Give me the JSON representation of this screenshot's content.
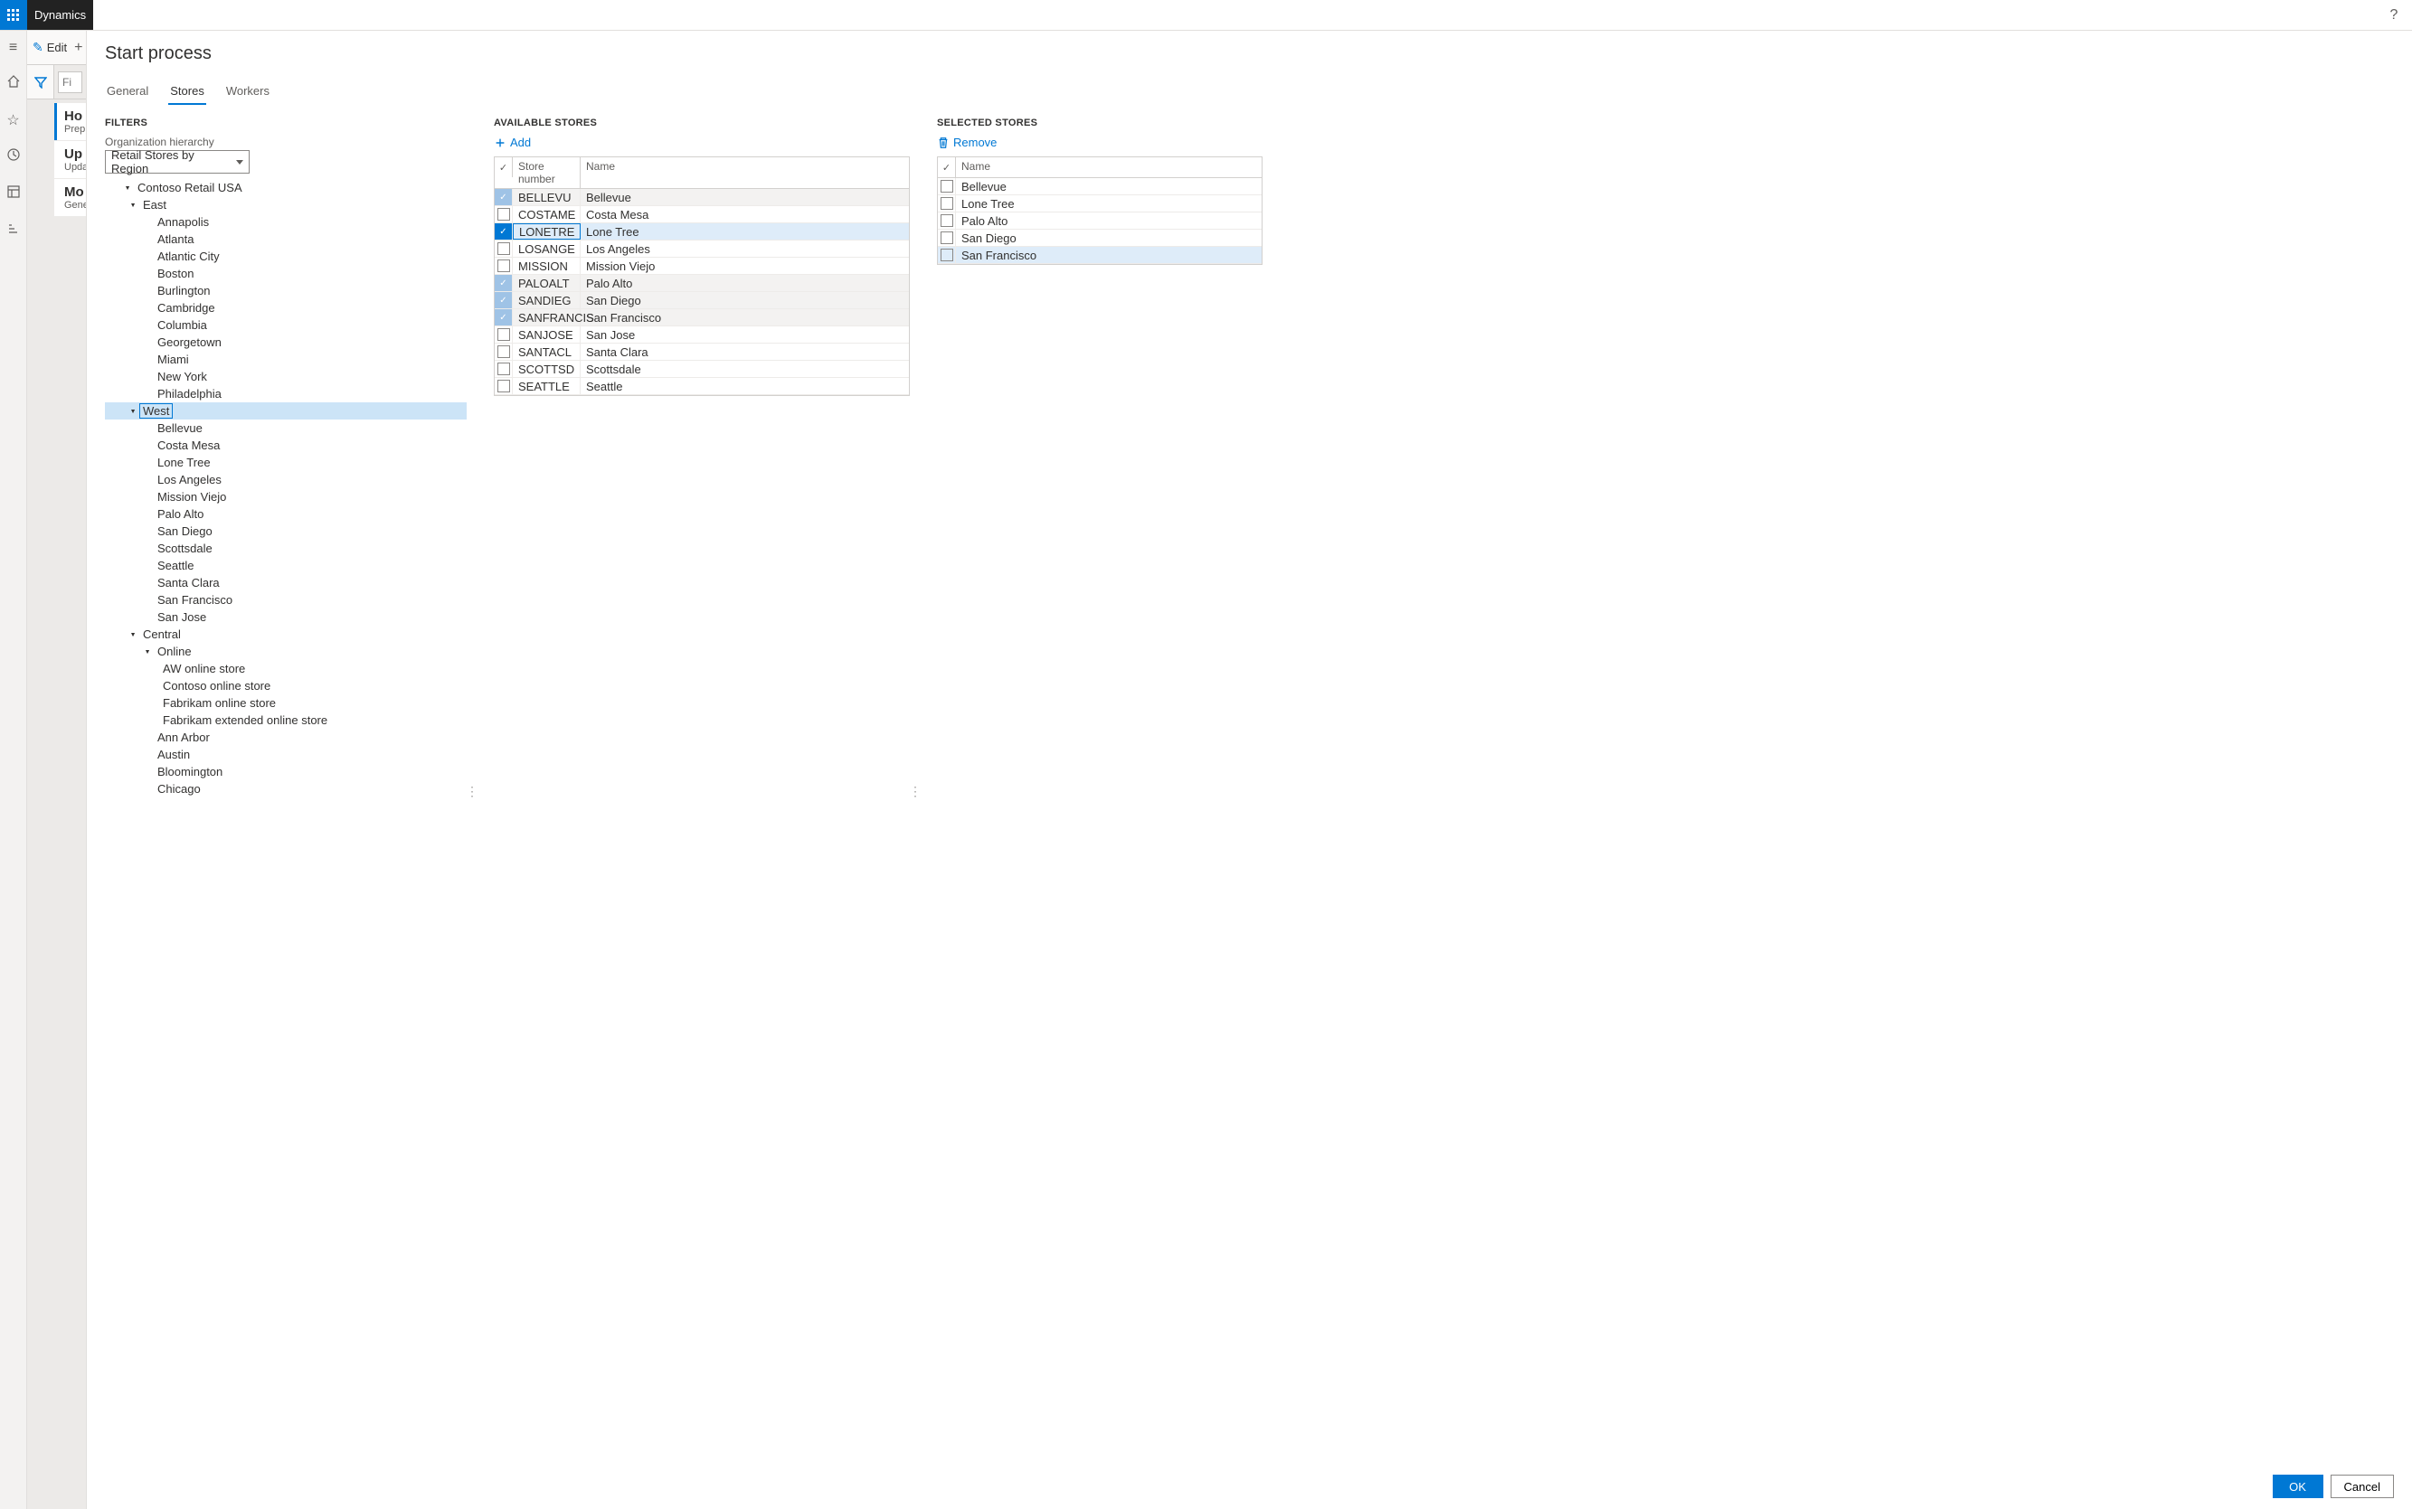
{
  "header": {
    "brand": "Dynamics"
  },
  "leftrail_icons": [
    "menu",
    "home",
    "star",
    "history",
    "doc",
    "list"
  ],
  "bgpage": {
    "toolbar_edit": "Edit",
    "filter_placeholder": "Fi",
    "items": [
      {
        "title": "Ho",
        "sub": "Prep",
        "active": true
      },
      {
        "title": "Up",
        "sub": "Upda",
        "active": false
      },
      {
        "title": "Mo",
        "sub": "Gene",
        "active": false
      }
    ]
  },
  "modal": {
    "title": "Start process",
    "tabs": [
      "General",
      "Stores",
      "Workers"
    ],
    "active_tab": "Stores",
    "ok": "OK",
    "cancel": "Cancel"
  },
  "filters": {
    "section": "FILTERS",
    "field_label": "Organization hierarchy",
    "select_value": "Retail Stores by Region",
    "tree": [
      {
        "label": "Contoso Retail USA",
        "indent": 0,
        "toggle": "▾"
      },
      {
        "label": "East",
        "indent": 1,
        "toggle": "▾"
      },
      {
        "label": "Annapolis",
        "indent": 2
      },
      {
        "label": "Atlanta",
        "indent": 2
      },
      {
        "label": "Atlantic City",
        "indent": 2
      },
      {
        "label": "Boston",
        "indent": 2
      },
      {
        "label": "Burlington",
        "indent": 2
      },
      {
        "label": "Cambridge",
        "indent": 2
      },
      {
        "label": "Columbia",
        "indent": 2
      },
      {
        "label": "Georgetown",
        "indent": 2
      },
      {
        "label": "Miami",
        "indent": 2
      },
      {
        "label": "New York",
        "indent": 2
      },
      {
        "label": "Philadelphia",
        "indent": 2
      },
      {
        "label": "West",
        "indent": 1,
        "toggle": "▾",
        "selected": true
      },
      {
        "label": "Bellevue",
        "indent": 2
      },
      {
        "label": "Costa Mesa",
        "indent": 2
      },
      {
        "label": "Lone Tree",
        "indent": 2
      },
      {
        "label": "Los Angeles",
        "indent": 2
      },
      {
        "label": "Mission Viejo",
        "indent": 2
      },
      {
        "label": "Palo Alto",
        "indent": 2
      },
      {
        "label": "San Diego",
        "indent": 2
      },
      {
        "label": "Scottsdale",
        "indent": 2
      },
      {
        "label": "Seattle",
        "indent": 2
      },
      {
        "label": "Santa Clara",
        "indent": 2
      },
      {
        "label": "San Francisco",
        "indent": 2
      },
      {
        "label": "San Jose",
        "indent": 2
      },
      {
        "label": "Central",
        "indent": 1,
        "toggle": "▾"
      },
      {
        "label": "Online",
        "indent": 2,
        "toggle": "▾"
      },
      {
        "label": "AW online store",
        "indent": 3
      },
      {
        "label": "Contoso online store",
        "indent": 3
      },
      {
        "label": "Fabrikam online store",
        "indent": 3
      },
      {
        "label": "Fabrikam extended online store",
        "indent": 3
      },
      {
        "label": "Ann Arbor",
        "indent": 2
      },
      {
        "label": "Austin",
        "indent": 2
      },
      {
        "label": "Bloomington",
        "indent": 2
      },
      {
        "label": "Chicago",
        "indent": 2
      }
    ]
  },
  "available": {
    "section": "AVAILABLE STORES",
    "add_label": "Add",
    "col_number": "Store number",
    "col_name": "Name",
    "rows": [
      {
        "num": "BELLEVU",
        "name": "Bellevue",
        "checked": "muted"
      },
      {
        "num": "COSTAME",
        "name": "Costa Mesa"
      },
      {
        "num": "LONETRE",
        "name": "Lone Tree",
        "checked": "on",
        "active": true
      },
      {
        "num": "LOSANGE",
        "name": "Los Angeles"
      },
      {
        "num": "MISSION",
        "name": "Mission Viejo"
      },
      {
        "num": "PALOALT",
        "name": "Palo Alto",
        "checked": "muted"
      },
      {
        "num": "SANDIEG",
        "name": "San Diego",
        "checked": "muted"
      },
      {
        "num": "SANFRANCIS",
        "name": "San Francisco",
        "checked": "muted"
      },
      {
        "num": "SANJOSE",
        "name": "San Jose"
      },
      {
        "num": "SANTACL",
        "name": "Santa Clara"
      },
      {
        "num": "SCOTTSD",
        "name": "Scottsdale"
      },
      {
        "num": "SEATTLE",
        "name": "Seattle"
      }
    ]
  },
  "selected": {
    "section": "SELECTED STORES",
    "remove_label": "Remove",
    "col_name": "Name",
    "rows": [
      {
        "name": "Bellevue"
      },
      {
        "name": "Lone Tree"
      },
      {
        "name": "Palo Alto"
      },
      {
        "name": "San Diego"
      },
      {
        "name": "San Francisco",
        "active": true
      }
    ]
  }
}
